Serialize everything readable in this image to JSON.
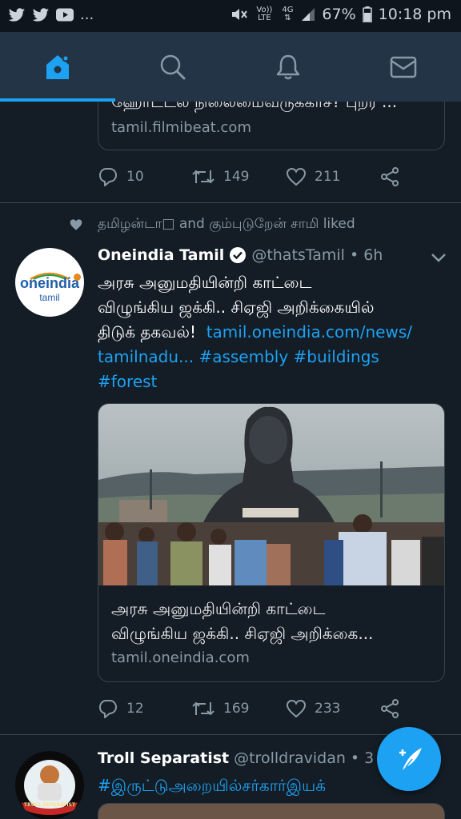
{
  "status_bar": {
    "more_indicator": "...",
    "volte": "Vo)) LTE",
    "network": "4G",
    "battery_percent": "67%",
    "time": "10:18 pm"
  },
  "nav": {
    "tabs": [
      {
        "icon": "home-icon",
        "active": true
      },
      {
        "icon": "search-icon",
        "active": false
      },
      {
        "icon": "bell-icon",
        "active": false
      },
      {
        "icon": "mail-icon",
        "active": false
      }
    ]
  },
  "tweet1": {
    "card_title_partial": "ஹோட்டல் நிலைமைவருக்காச? புறர ...",
    "card_domain": "tamil.filmibeat.com",
    "replies": "10",
    "retweets": "149",
    "likes": "211"
  },
  "tweet2": {
    "social_context": "தமிழன்டா□ and கும்புடுறேன் சாமி liked",
    "author_name": "Oneindia Tamil",
    "author_handle": "@thatsTamil",
    "time": "6h",
    "avatar_brand": "oneindia",
    "avatar_sub": "tamil",
    "text_line1": "அரசு அனுமதியின்றி காட்டை",
    "text_line2": "விழுங்கிய ஜக்கி.. சிஏஜி அறிக்கையில்",
    "text_line3": "திடுக் தகவல்!",
    "link_url": "tamil.oneindia.com/news/",
    "link_url2": "tamilnadu...",
    "hashtag1": "#assembly",
    "hashtag2": "#buildings",
    "hashtag3": "#forest",
    "card_title_line1": "அரசு அனுமதியின்றி காட்டை",
    "card_title_line2": "விழுங்கிய ஜக்கி.. சிஏஜி அறிக்கை...",
    "card_domain": "tamil.oneindia.com",
    "replies": "12",
    "retweets": "169",
    "likes": "233"
  },
  "tweet3": {
    "author_name": "Troll Separatist",
    "author_handle": "@trolldravidan",
    "time_partial": "3",
    "hashtag": "#இருட்டுஅறையில்சர்கார்இயக்",
    "avatar_label": "TROLL SEPARATIST"
  },
  "fab": {
    "icon": "compose-tweet-icon"
  }
}
